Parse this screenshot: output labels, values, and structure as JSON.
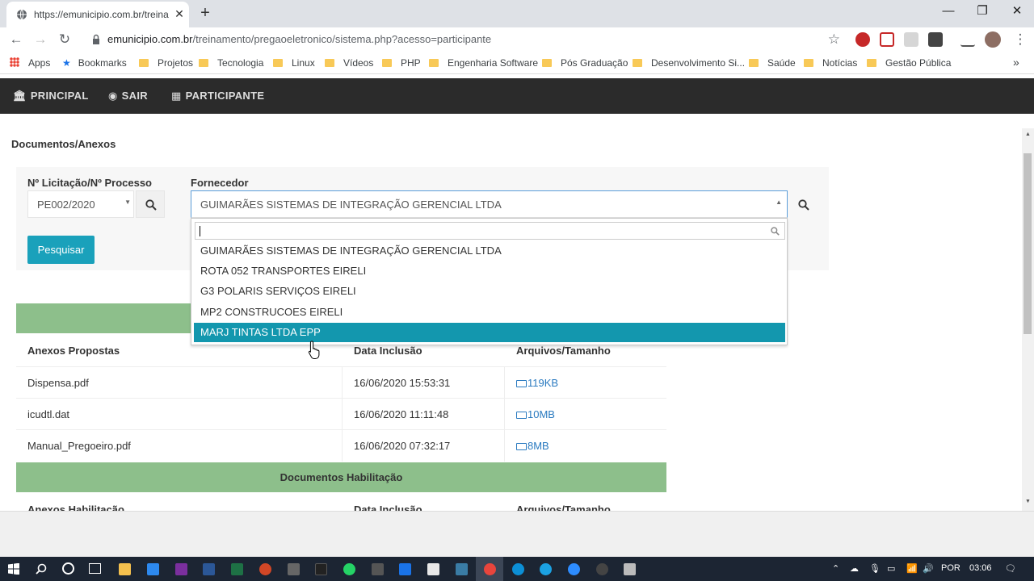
{
  "browser": {
    "tab_title": "https://emunicipio.com.br/treina",
    "tab_close": "✕",
    "new_tab": "+",
    "url_domain": "emunicipio.com.br",
    "url_path": "/treinamento/pregaoeletronico/sistema.php?acesso=participante",
    "win_minimize": "—",
    "win_restore": "❐",
    "win_close": "✕"
  },
  "bookmarks": [
    "Apps",
    "Bookmarks",
    "Projetos",
    "Tecnologia",
    "Linux",
    "Vídeos",
    "PHP",
    "Engenharia Software",
    "Pós Graduação",
    "Desenvolvimento Si...",
    "Saúde",
    "Notícias",
    "Gestão Pública"
  ],
  "bookmarks_more": "»",
  "nav": {
    "principal": "PRINCIPAL",
    "sair": "SAIR",
    "participante": "PARTICIPANTE"
  },
  "page": {
    "title": "Documentos/Anexos",
    "label_licitacao": "Nº Licitação/Nº Processo",
    "label_fornecedor": "Fornecedor",
    "licitacao_value": "PE002/2020",
    "fornecedor_value": "GUIMARÃES SISTEMAS DE INTEGRAÇÃO GERENCIAL LTDA",
    "search_button": "Pesquisar"
  },
  "dropdown": {
    "search_value": "",
    "options": [
      "GUIMARÃES SISTEMAS DE INTEGRAÇÃO GERENCIAL LTDA",
      "ROTA 052 TRANSPORTES EIRELI",
      "G3 POLARIS SERVIÇOS EIRELI",
      "MP2 CONSTRUCOES EIRELI",
      "MARJ TINTAS LTDA EPP"
    ],
    "highlighted_index": 4
  },
  "propostas": {
    "headers": [
      "Anexos Propostas",
      "Data Inclusão",
      "Arquivos/Tamanho"
    ],
    "rows": [
      {
        "nome": "Dispensa.pdf",
        "data": "16/06/2020 15:53:31",
        "tamanho": "119KB"
      },
      {
        "nome": "icudtl.dat",
        "data": "16/06/2020 11:11:48",
        "tamanho": "10MB"
      },
      {
        "nome": "Manual_Pregoeiro.pdf",
        "data": "16/06/2020 07:32:17",
        "tamanho": "8MB"
      }
    ]
  },
  "habilitacao": {
    "title": "Documentos Habilitação",
    "headers": [
      "Anexos Habilitação",
      "Data Inclusão",
      "Arquivos/Tamanho"
    ]
  },
  "taskbar": {
    "language": "POR",
    "time": "03:06"
  },
  "colors": {
    "navbar": "#2b2b2b",
    "accent_button": "#1aa1bb",
    "highlight": "#1397ae",
    "section_green": "#8dbf8b",
    "link": "#2a7ac0"
  }
}
